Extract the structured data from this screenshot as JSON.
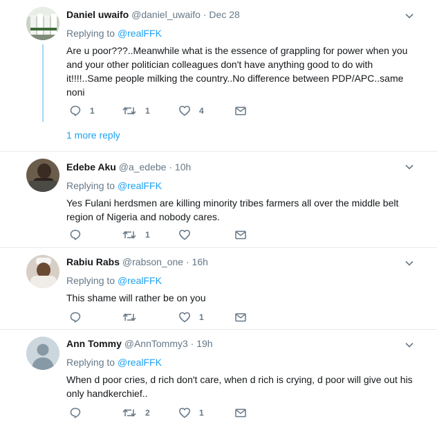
{
  "colors": {
    "accent": "#1da1f2",
    "muted": "#657786",
    "text": "#14171a",
    "divider": "#e6ecf0"
  },
  "tweets": [
    {
      "name": "Daniel uwaifo",
      "handle": "@daniel_uwaifo",
      "separator": "·",
      "time": "Dec 28",
      "replying_prefix": "Replying to",
      "replying_to": "@realFFK",
      "text": "Are u poor???..Meanwhile what is the essence of grappling for power when you and your other politician colleagues don't have anything good to do with it!!!!..Same people milking the country..No difference between PDP/APC..same noni",
      "reply_count": "1",
      "retweet_count": "1",
      "like_count": "4",
      "more_reply": "1 more reply"
    },
    {
      "name": "Edebe Aku",
      "handle": "@a_edebe",
      "separator": "·",
      "time": "10h",
      "replying_prefix": "Replying to",
      "replying_to": "@realFFK",
      "text": "Yes Fulani herdsmen are killing minority tribes farmers all over the middle belt region of Nigeria and nobody cares.",
      "reply_count": "",
      "retweet_count": "1",
      "like_count": ""
    },
    {
      "name": "Rabiu Rabs",
      "handle": "@rabson_one",
      "separator": "·",
      "time": "16h",
      "replying_prefix": "Replying to",
      "replying_to": "@realFFK",
      "text": "This shame will rather be on you",
      "reply_count": "",
      "retweet_count": "",
      "like_count": "1"
    },
    {
      "name": "Ann Tommy",
      "handle": "@AnnTommy3",
      "separator": "·",
      "time": "19h",
      "replying_prefix": "Replying to",
      "replying_to": "@realFFK",
      "text": "When d poor cries, d rich don't care, when d rich is crying, d poor will give out his only handkerchief..",
      "reply_count": "",
      "retweet_count": "2",
      "like_count": "1"
    }
  ]
}
